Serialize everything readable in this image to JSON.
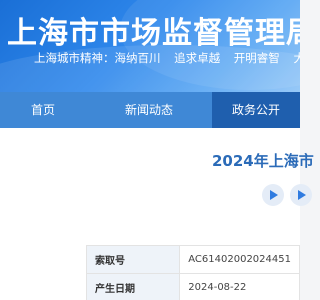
{
  "header": {
    "site_title": "上海市市场监督管理局",
    "slogan": "上海城市精神：海纳百川  追求卓越  开明睿智  大气谦和"
  },
  "nav": {
    "items": [
      {
        "label": "首页"
      },
      {
        "label": "新闻动态"
      },
      {
        "label": "政务公开",
        "active": true
      }
    ]
  },
  "main": {
    "heading": "2024年上海市",
    "info": [
      {
        "key": "索取号",
        "value": "AC61402002024451"
      },
      {
        "key": "产生日期",
        "value": "2024-08-22"
      }
    ]
  },
  "colors": {
    "header_blue": "#2f88ec",
    "nav_blue": "#3f88d6",
    "nav_active": "#1f5fae",
    "heading_blue": "#2b6bb8"
  },
  "icons": [
    "play-icon",
    "play-icon"
  ]
}
